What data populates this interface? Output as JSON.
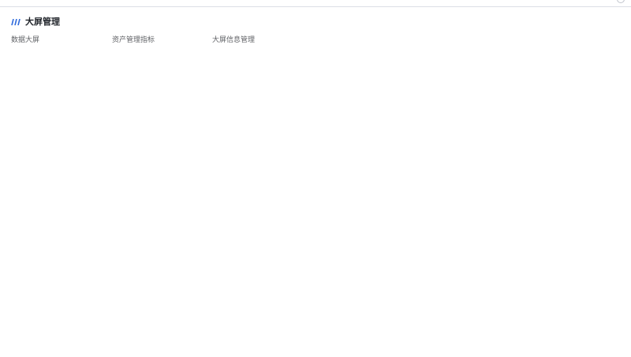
{
  "section": {
    "title": "大屏管理",
    "icon": "triple-slash-icon",
    "accent_color": "#2f6bdc"
  },
  "menu": {
    "items": [
      {
        "label": "数据大屏"
      },
      {
        "label": "资产管理指标"
      },
      {
        "label": "大屏信息管理"
      }
    ]
  }
}
